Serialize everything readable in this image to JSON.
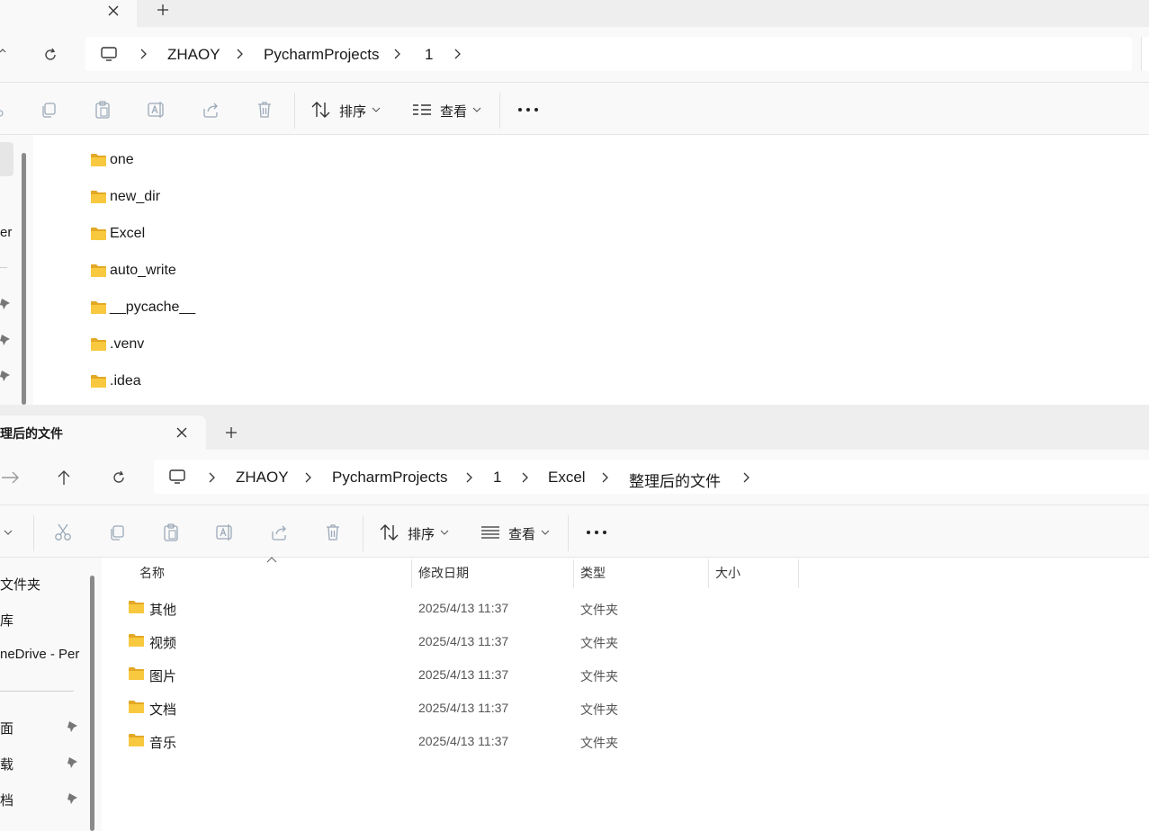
{
  "top": {
    "breadcrumb": [
      "ZHAOY",
      "PycharmProjects",
      "1"
    ],
    "toolbar": {
      "sort_label": "排序",
      "view_label": "查看"
    },
    "sidebar_fragment": "er",
    "items": [
      "one",
      "new_dir",
      "Excel",
      "auto_write",
      "__pycache__",
      ".venv",
      ".idea"
    ]
  },
  "bottom": {
    "tab_title": "理后的文件",
    "breadcrumb": [
      "ZHAOY",
      "PycharmProjects",
      "1",
      "Excel",
      "整理后的文件"
    ],
    "toolbar": {
      "sort_label": "排序",
      "view_label": "查看"
    },
    "columns": {
      "name": "名称",
      "modified": "修改日期",
      "type": "类型",
      "size": "大小"
    },
    "rows": [
      {
        "name": "其他",
        "modified": "2025/4/13 11:37",
        "type": "文件夹"
      },
      {
        "name": "视频",
        "modified": "2025/4/13 11:37",
        "type": "文件夹"
      },
      {
        "name": "图片",
        "modified": "2025/4/13 11:37",
        "type": "文件夹"
      },
      {
        "name": "文档",
        "modified": "2025/4/13 11:37",
        "type": "文件夹"
      },
      {
        "name": "音乐",
        "modified": "2025/4/13 11:37",
        "type": "文件夹"
      }
    ],
    "sidebar": {
      "items": [
        "文件夹",
        "库",
        "neDrive - Per"
      ],
      "pinned": [
        "面",
        "载",
        "档"
      ]
    }
  },
  "colors": {
    "folder_yellow": "#f8c93f",
    "folder_dark": "#e3a826",
    "titlebar_bg": "#eeeeee",
    "bar_bg": "#f9f9f9"
  }
}
